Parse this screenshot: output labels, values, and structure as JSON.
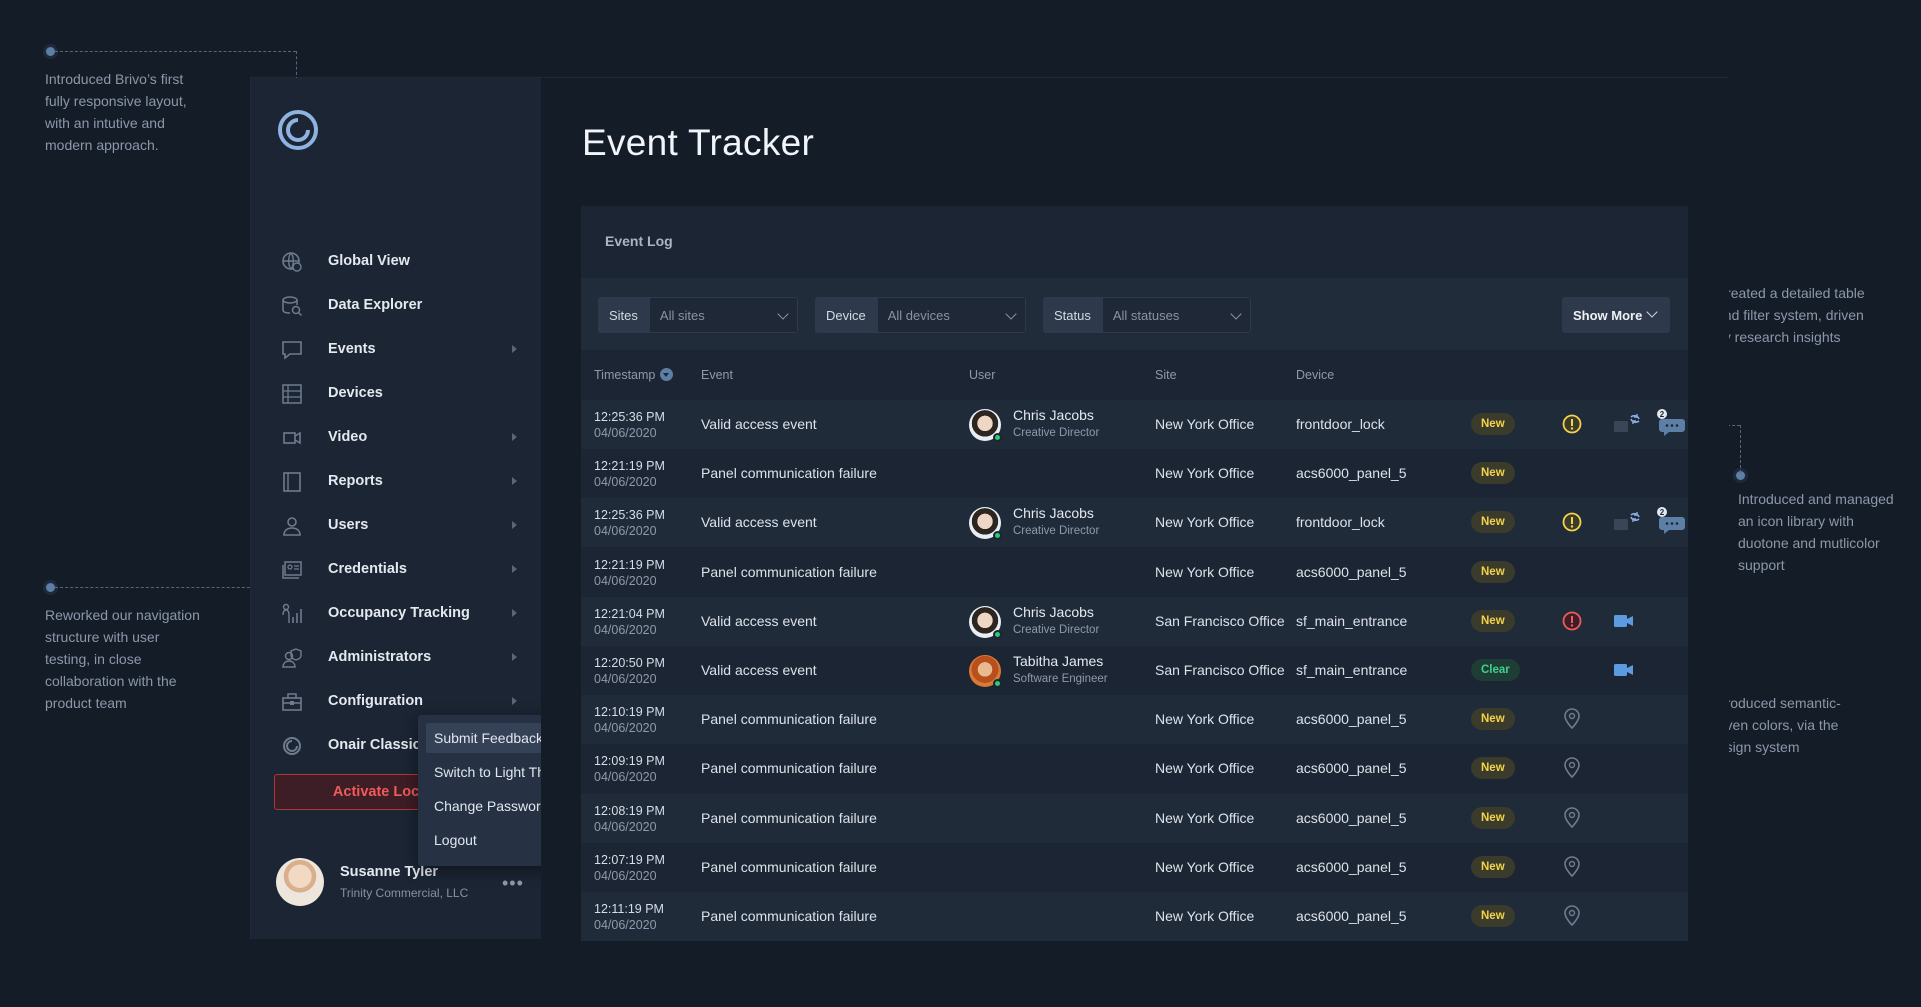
{
  "annotations": {
    "layout": "Introduced Brivo’s first fully responsive layout, with an intutive and modern approach.",
    "navigation": "Reworked our navigation structure with user testing, in close collaboration with the product team",
    "filters": "Created a detailed table and filter system, driven by research insights",
    "icons": "Introduced and managed an icon library with duotone and mutlicolor support",
    "colors": "Introduced semantic-driven colors, via the design system"
  },
  "sidebar": {
    "items": [
      {
        "label": "Global View",
        "icon": "globe-icon",
        "chevron": false
      },
      {
        "label": "Data Explorer",
        "icon": "data-explorer-icon",
        "chevron": false
      },
      {
        "label": "Events",
        "icon": "chat-bubble-icon",
        "chevron": true
      },
      {
        "label": "Devices",
        "icon": "devices-icon",
        "chevron": false
      },
      {
        "label": "Video",
        "icon": "video-camera-icon",
        "chevron": true
      },
      {
        "label": "Reports",
        "icon": "reports-icon",
        "chevron": true
      },
      {
        "label": "Users",
        "icon": "user-icon",
        "chevron": true
      },
      {
        "label": "Credentials",
        "icon": "credentials-icon",
        "chevron": true
      },
      {
        "label": "Occupancy Tracking",
        "icon": "occupancy-icon",
        "chevron": true
      },
      {
        "label": "Administrators",
        "icon": "admin-icon",
        "chevron": true
      },
      {
        "label": "Configuration",
        "icon": "toolbox-icon",
        "chevron": true
      },
      {
        "label": "Onair Classic",
        "icon": "onair-icon",
        "chevron": false,
        "external": true
      }
    ],
    "lockdown_label": "Activate Lockdown",
    "profile": {
      "name": "Susanne Tyler",
      "company": "Trinity Commercial, LLC",
      "more": "•••"
    },
    "menu": [
      "Submit Feedback",
      "Switch to Light Theme",
      "Change Password",
      "Logout"
    ]
  },
  "main": {
    "title": "Event Tracker",
    "panel_title": "Event Log",
    "filters": [
      {
        "label": "Sites",
        "value": "All sites"
      },
      {
        "label": "Device",
        "value": "All devices"
      },
      {
        "label": "Status",
        "value": "All statuses"
      }
    ],
    "show_more": "Show More",
    "columns": [
      "Timestamp",
      "Event",
      "User",
      "Site",
      "Device"
    ],
    "rows": [
      {
        "time": "12:25:36 PM",
        "date": "04/06/2020",
        "event": "Valid access event",
        "user": "Chris Jacobs",
        "role": "Creative Director",
        "site": "New York Office",
        "device": "frontdoor_lock",
        "status": "New"
      },
      {
        "time": "12:21:19 PM",
        "date": "04/06/2020",
        "event": "Panel communication failure",
        "user": "",
        "role": "",
        "site": "New York Office",
        "device": "acs6000_panel_5",
        "status": "New"
      },
      {
        "time": "12:25:36 PM",
        "date": "04/06/2020",
        "event": "Valid access event",
        "user": "Chris Jacobs",
        "role": "Creative Director",
        "site": "New York Office",
        "device": "frontdoor_lock",
        "status": "New"
      },
      {
        "time": "12:21:19 PM",
        "date": "04/06/2020",
        "event": "Panel communication failure",
        "user": "",
        "role": "",
        "site": "New York Office",
        "device": "acs6000_panel_5",
        "status": "New"
      },
      {
        "time": "12:21:04 PM",
        "date": "04/06/2020",
        "event": "Valid access event",
        "user": "Chris Jacobs",
        "role": "Creative Director",
        "site": "San Francisco Office",
        "device": "sf_main_entrance",
        "status": "New"
      },
      {
        "time": "12:20:50 PM",
        "date": "04/06/2020",
        "event": "Valid access event",
        "user": "Tabitha James",
        "role": "Software Engineer",
        "site": "San Francisco Office",
        "device": "sf_main_entrance",
        "status": "Clear"
      },
      {
        "time": "12:10:19 PM",
        "date": "04/06/2020",
        "event": "Panel communication failure",
        "user": "",
        "role": "",
        "site": "New York Office",
        "device": "acs6000_panel_5",
        "status": "New"
      },
      {
        "time": "12:09:19 PM",
        "date": "04/06/2020",
        "event": "Panel communication failure",
        "user": "",
        "role": "",
        "site": "New York Office",
        "device": "acs6000_panel_5",
        "status": "New"
      },
      {
        "time": "12:08:19 PM",
        "date": "04/06/2020",
        "event": "Panel communication failure",
        "user": "",
        "role": "",
        "site": "New York Office",
        "device": "acs6000_panel_5",
        "status": "New"
      },
      {
        "time": "12:07:19 PM",
        "date": "04/06/2020",
        "event": "Panel communication failure",
        "user": "",
        "role": "",
        "site": "New York Office",
        "device": "acs6000_panel_5",
        "status": "New"
      },
      {
        "time": "12:11:19 PM",
        "date": "04/06/2020",
        "event": "Panel communication failure",
        "user": "",
        "role": "",
        "site": "New York Office",
        "device": "acs6000_panel_5",
        "status": "New"
      }
    ],
    "chat_count": "2"
  },
  "colors": {
    "accent": "#5d7fa6",
    "new": "#f3d34a",
    "clear": "#3fd18e",
    "danger": "#f05a5a",
    "online": "#2ecc71"
  }
}
